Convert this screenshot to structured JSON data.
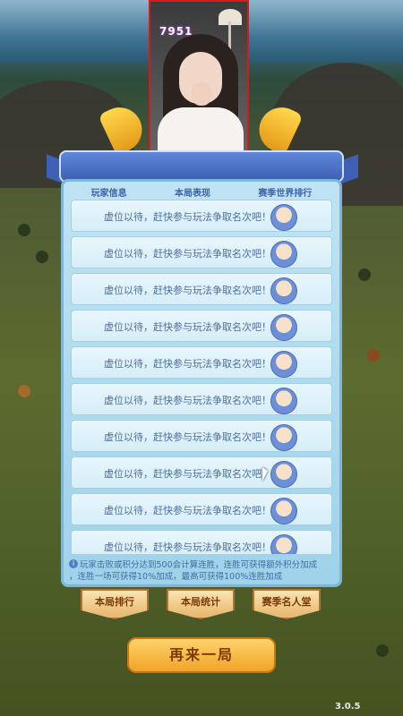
{
  "stream": {
    "counter": "7951"
  },
  "panel": {
    "headers": [
      "玩家信息",
      "本局表现",
      "赛季世界排行"
    ],
    "rows": [
      "虚位以待，赶快参与玩法争取名次吧！",
      "虚位以待，赶快参与玩法争取名次吧！",
      "虚位以待，赶快参与玩法争取名次吧！",
      "虚位以待，赶快参与玩法争取名次吧！",
      "虚位以待，赶快参与玩法争取名次吧！",
      "虚位以待，赶快参与玩法争取名次吧！",
      "虚位以待，赶快参与玩法争取名次吧！",
      "虚位以待，赶快参与玩法争取名次吧！",
      "虚位以待，赶快参与玩法争取名次吧！",
      "虚位以待，赶快参与玩法争取名次吧！"
    ],
    "notice_line1": "玩家击败或积分达到500会计算连胜，连胜可获得额外积分加成",
    "notice_line2": "，连胜一场可获得10%加成，最高可获得100%连胜加成",
    "info_icon": "i"
  },
  "tabs": [
    "本局排行",
    "本局统计",
    "赛季名人堂"
  ],
  "replay_label": "再来一局",
  "version": "3.0.5",
  "colors": {
    "accent": "#f0a427",
    "panel": "#bfe3f3",
    "stream_border": "#d41a1a"
  }
}
